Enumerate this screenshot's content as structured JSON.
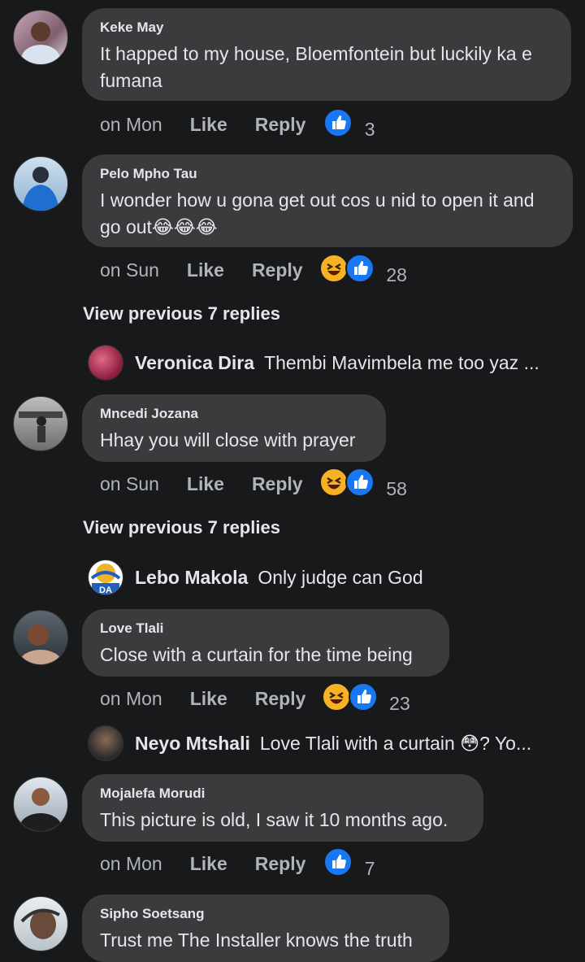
{
  "comments": [
    {
      "name": "Keke May",
      "text": "It happed to my house, Bloemfontein but luckily ka e fumana",
      "time": "on Mon",
      "like": "Like",
      "reply": "Reply",
      "reactions": "like",
      "count": "3"
    },
    {
      "name": "Pelo Mpho Tau",
      "text": "I wonder how u gona get out cos u nid to open it and go out😂😂😂",
      "time": "on Sun",
      "like": "Like",
      "reply": "Reply",
      "reactions": "haha+like",
      "count": "28"
    },
    {
      "name": "Mncedi Jozana",
      "text": "Hhay you will close with prayer",
      "time": "on Sun",
      "like": "Like",
      "reply": "Reply",
      "reactions": "haha+like",
      "count": "58"
    },
    {
      "name": "Love Tlali",
      "text": "Close with a curtain for the time being",
      "time": "on Mon",
      "like": "Like",
      "reply": "Reply",
      "reactions": "haha+like",
      "count": "23"
    },
    {
      "name": "Mojalefa Morudi",
      "text": "This picture is old, I saw it 10 months ago.",
      "time": "on Mon",
      "like": "Like",
      "reply": "Reply",
      "reactions": "like",
      "count": "7"
    },
    {
      "name": "Sipho Soetsang",
      "text": "Trust me The Installer knows the truth"
    }
  ],
  "view_previous": [
    "View previous 7 replies",
    "View previous 7 replies"
  ],
  "replies": [
    {
      "name": "Veronica Dira",
      "text": "Thembi Mavimbela me too yaz ..."
    },
    {
      "name": "Lebo Makola",
      "text": "Only judge can God",
      "avatar_text": "DA"
    },
    {
      "name": "Neyo Mtshali",
      "text": "Love Tlali with a curtain 😳? Yo..."
    }
  ],
  "colors": {
    "background": "#18191a",
    "bubble": "#3a3b3c",
    "like_blue": "#1877f2",
    "haha_yellow": "#f7b125",
    "muted": "#b0b3b8"
  }
}
